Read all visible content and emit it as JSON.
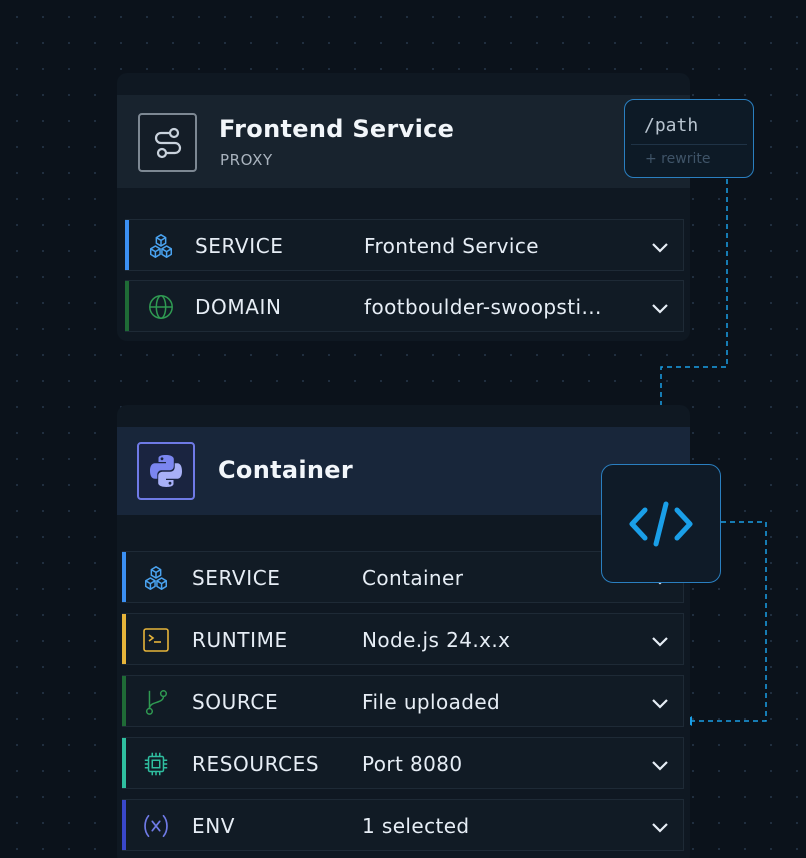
{
  "colors": {
    "accent": "#1a9fe8",
    "bar_service": "#3b8ff2",
    "bar_domain": "#1f6b36",
    "bar_runtime": "#e6b43a",
    "bar_source": "#1f6b36",
    "bar_resources": "#2fbfa0",
    "bar_env": "#3947c9"
  },
  "frontend": {
    "title": "Frontend Service",
    "subtitle": "PROXY",
    "icon": "route-icon",
    "rows": [
      {
        "label": "SERVICE",
        "value": "Frontend Service",
        "icon": "cubes-icon"
      },
      {
        "label": "DOMAIN",
        "value": "footboulder-swoopsti...",
        "icon": "globe-icon"
      }
    ]
  },
  "path_node": {
    "path": "/path",
    "rewrite": "+ rewrite"
  },
  "container": {
    "title": "Container",
    "icon": "python-icon",
    "rows": [
      {
        "label": "SERVICE",
        "value": "Container",
        "icon": "cubes-icon"
      },
      {
        "label": "RUNTIME",
        "value": "Node.js 24.x.x",
        "icon": "terminal-icon"
      },
      {
        "label": "SOURCE",
        "value": "File uploaded",
        "icon": "git-branch-icon"
      },
      {
        "label": "RESOURCES",
        "value": "Port 8080",
        "icon": "chip-icon"
      },
      {
        "label": "ENV",
        "value": "1 selected",
        "icon": "variable-icon"
      }
    ]
  },
  "code_node": {
    "icon": "code-icon"
  }
}
